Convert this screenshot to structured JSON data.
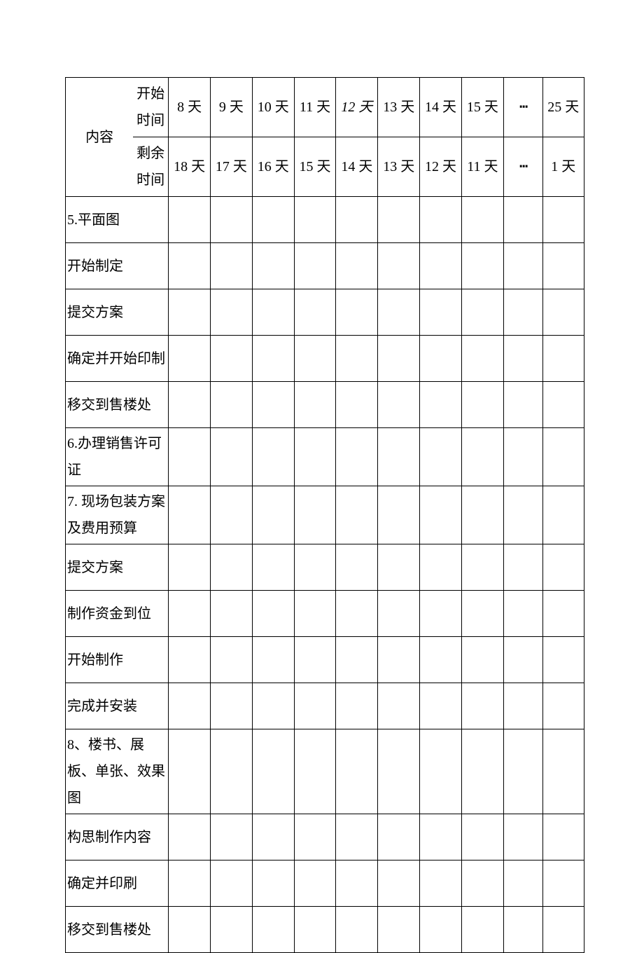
{
  "header": {
    "content_label": "内容",
    "start_time_label": "开始时间",
    "remain_time_label": "剩余时间",
    "days_top": [
      "8 天",
      "9 天",
      "10 天",
      "11 天",
      "12 天",
      "13 天",
      "14 天",
      "15 天",
      "┅",
      "25 天"
    ],
    "days_bot": [
      "18 天",
      "17 天",
      "16 天",
      "15 天",
      "14 天",
      "13 天",
      "12 天",
      "11 天",
      "┅",
      "1 天"
    ]
  },
  "rows": {
    "r1": "5.平面图",
    "r2": "开始制定",
    "r3": "提交方案",
    "r4": "确定并开始印制",
    "r5": "移交到售楼处",
    "r6": "6.办理销售许可证",
    "r7": "7. 现场包装方案及费用预算",
    "r8": "提交方案",
    "r9": "制作资金到位",
    "r10": "开始制作",
    "r11": "完成并安装",
    "r12": "8、楼书、展板、单张、效果图",
    "r13": "构思制作内容",
    "r14": "确定并印刷",
    "r15": "移交到售楼处"
  }
}
